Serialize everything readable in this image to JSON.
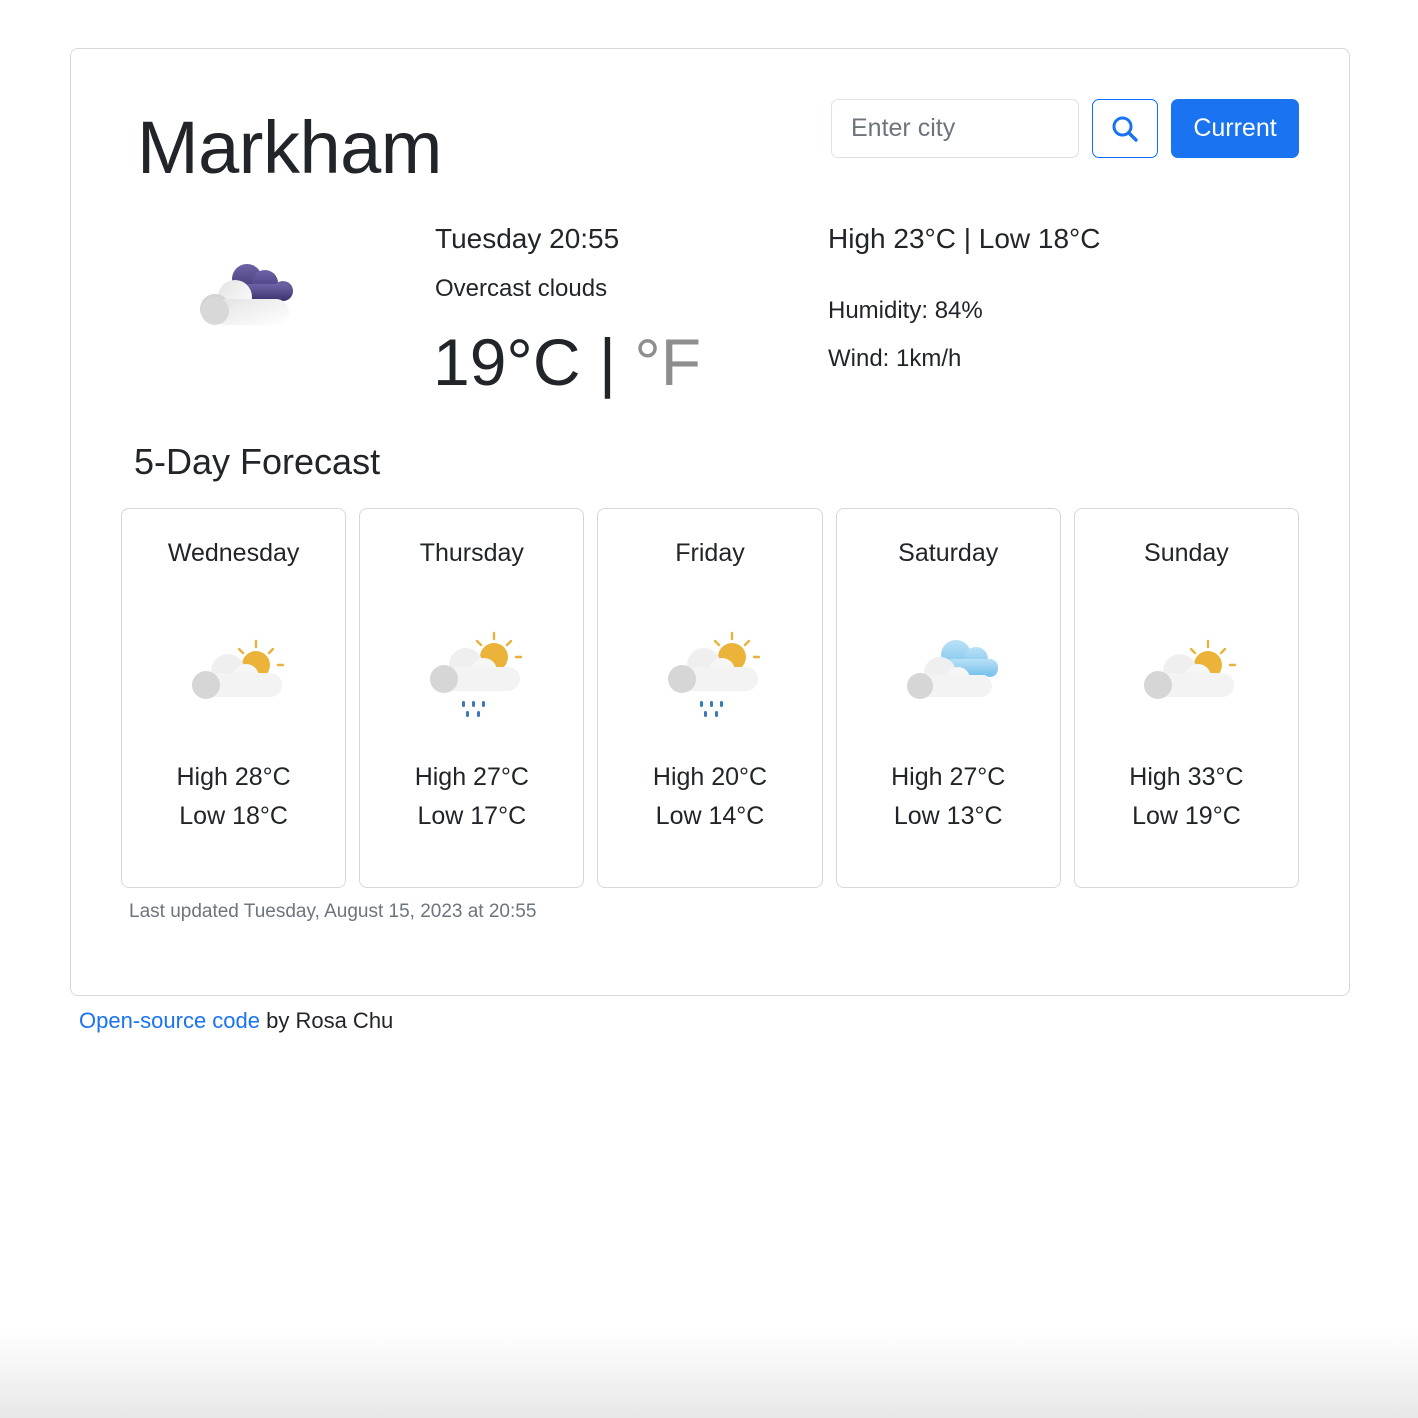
{
  "header": {
    "city": "Markham",
    "search_placeholder": "Enter city",
    "current_label": "Current"
  },
  "current": {
    "icon": "overcast-clouds-night-icon",
    "date_time": "Tuesday 20:55",
    "description": "Overcast clouds",
    "temperature": "19",
    "unit_c": "°C",
    "unit_separator": "|",
    "unit_f": "°F",
    "high_low": "High 23°C | Low 18°C",
    "humidity": "Humidity: 84%",
    "wind": "Wind: 1km/h"
  },
  "forecast": {
    "title": "5-Day Forecast",
    "days": [
      {
        "name": "Wednesday",
        "icon": "partly-cloudy-sun-icon",
        "high": "High 28°C",
        "low": "Low 18°C"
      },
      {
        "name": "Thursday",
        "icon": "rain-sun-cloud-icon",
        "high": "High 27°C",
        "low": "Low 17°C"
      },
      {
        "name": "Friday",
        "icon": "rain-sun-cloud-icon",
        "high": "High 20°C",
        "low": "Low 14°C"
      },
      {
        "name": "Saturday",
        "icon": "cloudy-icon",
        "high": "High 27°C",
        "low": "Low 13°C"
      },
      {
        "name": "Sunday",
        "icon": "partly-cloudy-sun-icon",
        "high": "High 33°C",
        "low": "Low 19°C"
      }
    ],
    "last_updated": "Last updated Tuesday, August 15, 2023 at 20:55"
  },
  "footer": {
    "link_text": "Open-source code",
    "suffix": " by Rosa Chu"
  },
  "colors": {
    "primary": "#1a73f0",
    "muted_text": "#6c757d",
    "border": "#d8d8d8"
  }
}
